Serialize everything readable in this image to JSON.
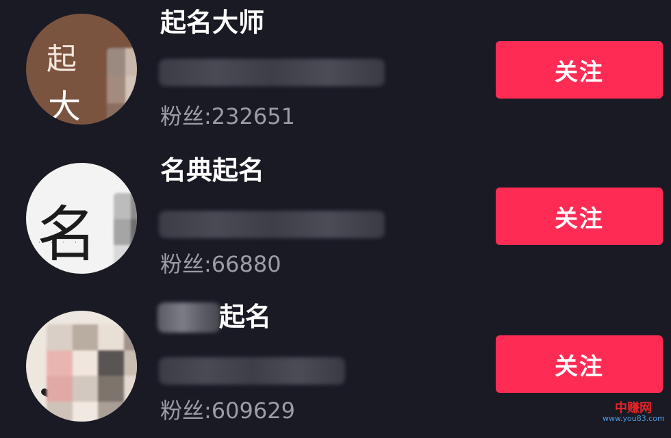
{
  "accounts": [
    {
      "name": "起名大师",
      "fans_label": "粉丝:232651",
      "follow_label": "关注",
      "avatar_text": [
        "起",
        "大"
      ]
    },
    {
      "name": "名典起名",
      "fans_label": "粉丝:66880",
      "follow_label": "关注",
      "avatar_text": [
        "名"
      ]
    },
    {
      "name": "起名",
      "fans_label": "粉丝:609629",
      "follow_label": "关注"
    }
  ],
  "colors": {
    "background": "#1a1a25",
    "follow_button": "#fe2c55",
    "secondary_text": "#9d9da6"
  },
  "watermark": {
    "cn": "中赚网",
    "url": "www.you83.com"
  }
}
